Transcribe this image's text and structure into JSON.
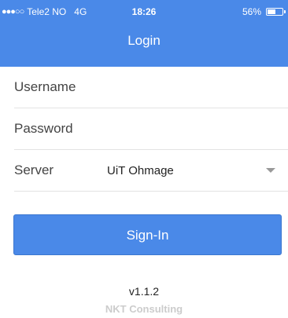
{
  "status": {
    "carrier": "Tele2 NO",
    "network": "4G",
    "time": "18:26",
    "battery": "56%",
    "battery_level": 0.56
  },
  "header": {
    "title": "Login"
  },
  "form": {
    "username_placeholder": "Username",
    "password_placeholder": "Password",
    "server_label": "Server",
    "server_value": "UiT Ohmage"
  },
  "signin_label": "Sign-In",
  "footer": {
    "version": "v1.1.2",
    "company": "NKT Consulting"
  },
  "colors": {
    "accent": "#4a89e8"
  },
  "icons": {
    "signal": "signal-dots-icon",
    "battery": "battery-icon",
    "dropdown": "chevron-down-icon"
  }
}
